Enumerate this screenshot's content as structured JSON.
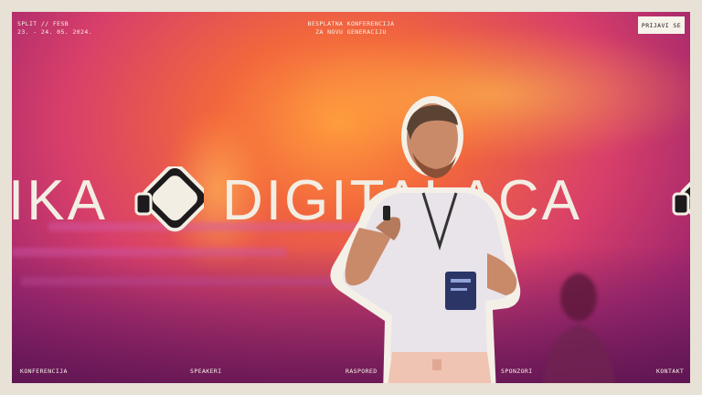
{
  "header": {
    "location_line": "SPLIT // FESB",
    "date_line": "23. - 24. 05. 2024.",
    "tagline_line1": "BESPLATNA KONFERENCIJA",
    "tagline_line2": "ZA NOVU GENERACIJU",
    "signup_label": "PRIJAVI SE"
  },
  "hero": {
    "marquee_fragment_left": "IKA",
    "marquee_word": "DIGITALACA"
  },
  "nav": {
    "items": [
      "KONFERENCIJA",
      "SPEAKERI",
      "RASPORED",
      "SPONZORI",
      "KONTAKT"
    ]
  },
  "colors": {
    "frame_bg": "#e8e2d6",
    "text_light": "#f3eee4",
    "accent_orange": "#f2663d",
    "accent_magenta": "#d83f6a",
    "badge_navy": "#2b3566"
  },
  "icons": [
    "arrow-logo-icon"
  ]
}
